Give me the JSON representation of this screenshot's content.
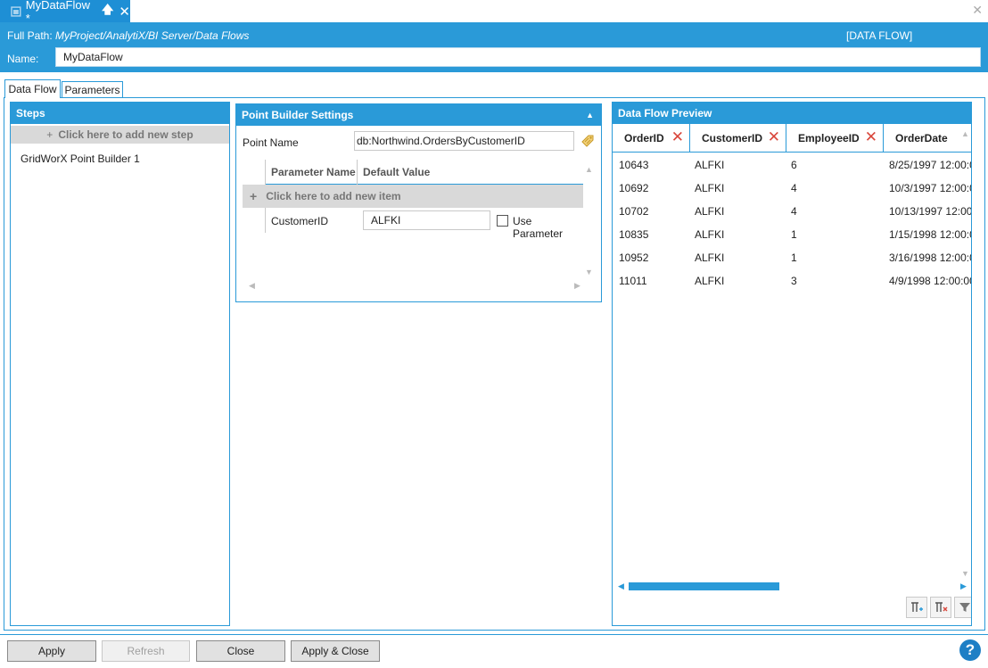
{
  "document_tab": {
    "title": "MyDataFlow *",
    "pin_glyph": "🡅",
    "close_glyph": "✕"
  },
  "window": {
    "close_glyph": "✕"
  },
  "header": {
    "fullpath_label": "Full Path:",
    "fullpath_value": "MyProject/AnalytiX/BI Server/Data Flows",
    "type_label": "[DATA FLOW]",
    "name_label": "Name:",
    "name_value": "MyDataFlow"
  },
  "tabs": [
    {
      "label": "Data Flow",
      "active": true
    },
    {
      "label": "Parameters",
      "active": false
    }
  ],
  "steps_panel": {
    "title": "Steps",
    "add_label": "Click here to add new step",
    "items": [
      "GridWorX Point Builder  1"
    ]
  },
  "point_builder": {
    "title": "Point Builder Settings",
    "collapse_glyph": "▲",
    "point_name_label": "Point Name",
    "point_name_value": "db:Northwind.OrdersByCustomerID",
    "columns": [
      "Parameter Name",
      "Default Value"
    ],
    "add_item_label": "Click here to add new item",
    "rows": [
      {
        "name": "CustomerID",
        "value": "ALFKI",
        "use_parameter_label": "Use Parameter",
        "use_parameter_checked": false
      }
    ]
  },
  "preview": {
    "title": "Data Flow Preview",
    "columns": [
      "OrderID",
      "CustomerID",
      "EmployeeID",
      "OrderDate"
    ],
    "rows": [
      [
        "10643",
        "ALFKI",
        "6",
        "8/25/1997 12:00:0"
      ],
      [
        "10692",
        "ALFKI",
        "4",
        "10/3/1997 12:00:0"
      ],
      [
        "10702",
        "ALFKI",
        "4",
        "10/13/1997 12:00"
      ],
      [
        "10835",
        "ALFKI",
        "1",
        "1/15/1998 12:00:0"
      ],
      [
        "10952",
        "ALFKI",
        "1",
        "3/16/1998 12:00:0"
      ],
      [
        "11011",
        "ALFKI",
        "3",
        "4/9/1998 12:00:00"
      ]
    ],
    "remove_glyph": "✕",
    "tools": [
      "column-add-icon",
      "column-remove-icon",
      "filter-icon"
    ]
  },
  "footer": {
    "apply": "Apply",
    "refresh": "Refresh",
    "close": "Close",
    "apply_close": "Apply & Close",
    "help_glyph": "?"
  },
  "colors": {
    "accent": "#2a9ad8",
    "remove": "#d9463b"
  }
}
